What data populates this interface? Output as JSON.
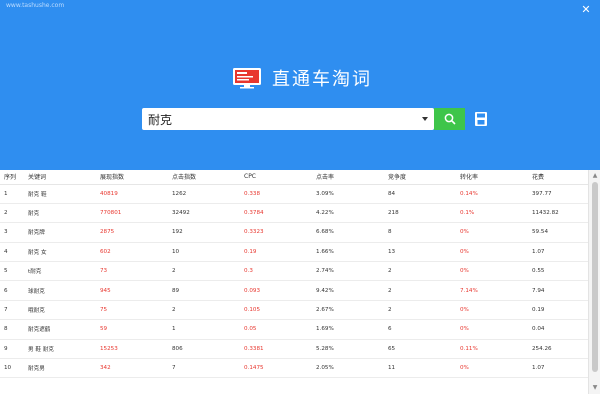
{
  "window": {
    "watermark": "www.tashushe.com",
    "close_glyph": "✕"
  },
  "brand": {
    "title": "直通车淘词",
    "icon": "monitor-chart-icon"
  },
  "search": {
    "value": "耐克",
    "dropdown_icon": "chevron-down-icon",
    "button_icon": "search-icon",
    "save_icon": "save-icon",
    "button_color": "#3ec54a"
  },
  "table": {
    "headers": [
      "序列",
      "关键词",
      "展现指数",
      "点击指数",
      "CPC",
      "点击率",
      "竞争度",
      "转化率",
      "花费"
    ],
    "rows": [
      [
        "1",
        "耐克 鞋",
        "40819",
        "1262",
        "0.338",
        "3.09%",
        "84",
        "0.14%",
        "397.77"
      ],
      [
        "2",
        "耐克",
        "770801",
        "32492",
        "0.3784",
        "4.22%",
        "218",
        "0.1%",
        "11432.82"
      ],
      [
        "3",
        "耐克牌",
        "2875",
        "192",
        "0.3323",
        "6.68%",
        "8",
        "0%",
        "59.54"
      ],
      [
        "4",
        "耐克 女",
        "602",
        "10",
        "0.19",
        "1.66%",
        "13",
        "0%",
        "1.07"
      ],
      [
        "5",
        "t耐克",
        "73",
        "2",
        "0.3",
        "2.74%",
        "2",
        "0%",
        "0.55"
      ],
      [
        "6",
        "球耐克",
        "945",
        "89",
        "0.093",
        "9.42%",
        "2",
        "7.14%",
        "7.94"
      ],
      [
        "7",
        "哦耐克",
        "75",
        "2",
        "0.105",
        "2.67%",
        "2",
        "0%",
        "0.19"
      ],
      [
        "8",
        "耐克遮鹤",
        "59",
        "1",
        "0.05",
        "1.69%",
        "6",
        "0%",
        "0.04"
      ],
      [
        "9",
        "男 鞋 耐克",
        "15253",
        "806",
        "0.3381",
        "5.28%",
        "65",
        "0.11%",
        "254.26"
      ],
      [
        "10",
        "耐克男",
        "342",
        "7",
        "0.1475",
        "2.05%",
        "11",
        "0%",
        "1.07"
      ]
    ]
  },
  "colors": {
    "header_bg": "#2f8ef0",
    "accent_red": "#e8372f"
  }
}
